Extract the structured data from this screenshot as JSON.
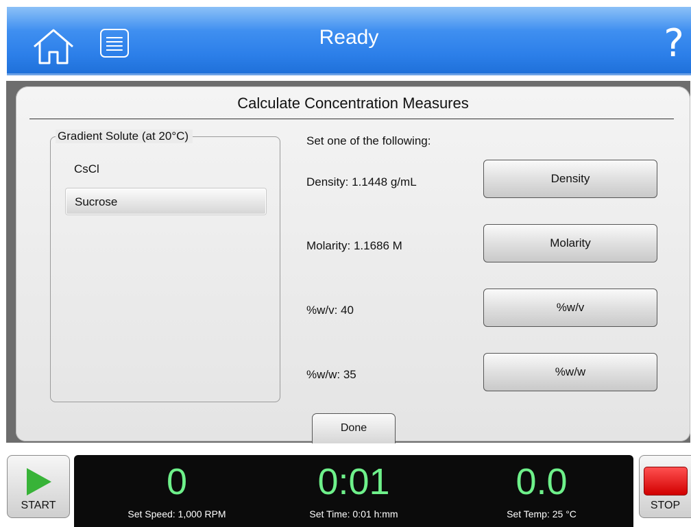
{
  "header": {
    "title": "Ready",
    "help_label": "?"
  },
  "dialog": {
    "title": "Calculate Concentration Measures",
    "group_label": "Gradient Solute (at 20°C)",
    "solutes": [
      {
        "label": "CsCl",
        "selected": false
      },
      {
        "label": "Sucrose",
        "selected": true
      }
    ],
    "set_instruction": "Set one of the following:",
    "rows": [
      {
        "value_label": "Density: 1.1448 g/mL",
        "button_label": "Density"
      },
      {
        "value_label": "Molarity: 1.1686 M",
        "button_label": "Molarity"
      },
      {
        "value_label": "%w/v: 40",
        "button_label": "%w/v"
      },
      {
        "value_label": "%w/w: 35",
        "button_label": "%w/w"
      }
    ],
    "done_label": "Done"
  },
  "status": {
    "start_label": "START",
    "stop_label": "STOP",
    "speed_value": "0",
    "speed_set": "Set Speed: 1,000 RPM",
    "time_value": "0:01",
    "time_set": "Set Time: 0:01 h:mm",
    "temp_value": "0.0",
    "temp_set": "Set Temp: 25 °C"
  },
  "colors": {
    "header_blue": "#2c7fe9",
    "readout_green": "#6ef08a",
    "start_green": "#38b338",
    "stop_red": "#e00000"
  }
}
